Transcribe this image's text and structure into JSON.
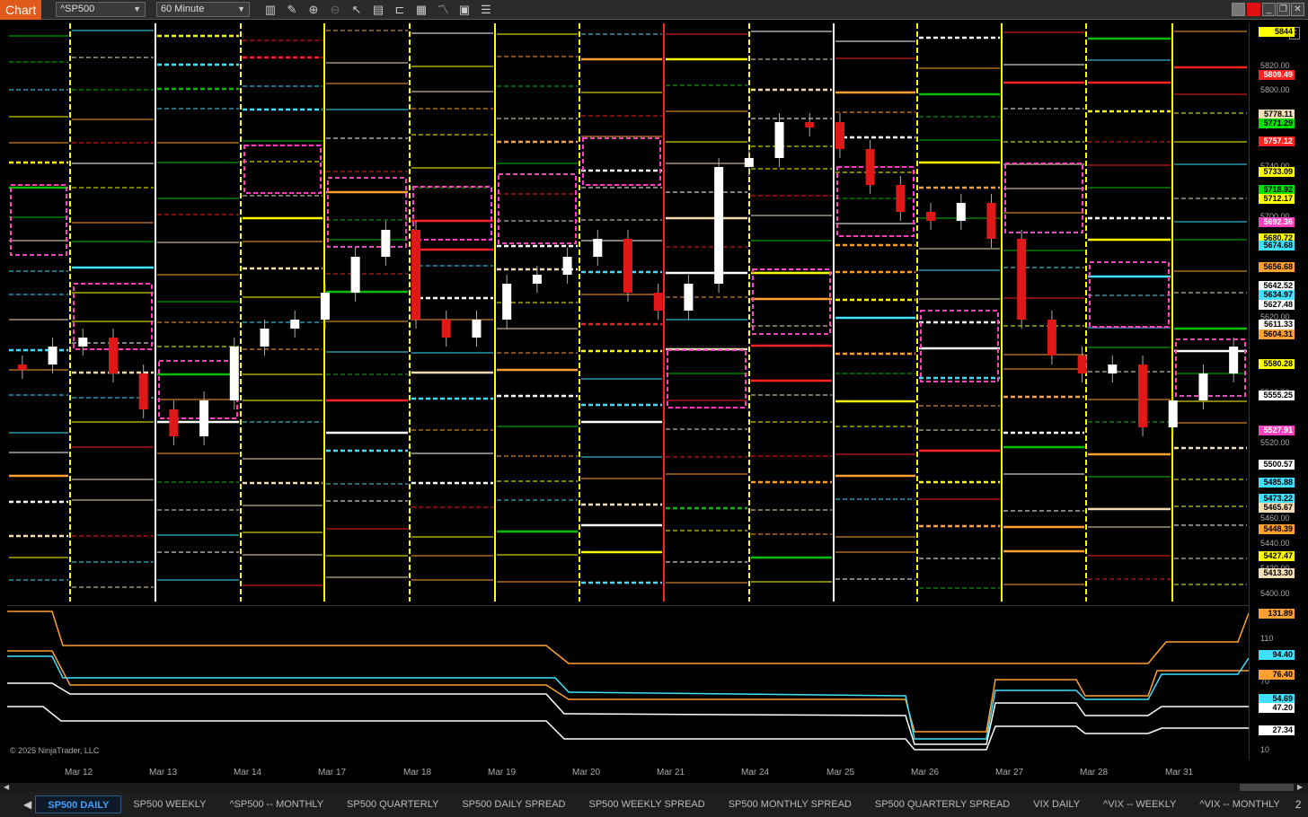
{
  "toolbar": {
    "chart_label": "Chart",
    "instrument": "^SP500",
    "interval": "60 Minute"
  },
  "copyright": "© 2025 NinjaTrader, LLC",
  "x_axis": [
    "Mar 12",
    "Mar 13",
    "Mar 14",
    "Mar 17",
    "Mar 18",
    "Mar 19",
    "Mar 20",
    "Mar 21",
    "Mar 24",
    "Mar 25",
    "Mar 26",
    "Mar 27",
    "Mar 28",
    "Mar 31"
  ],
  "price_axis_labels": [
    "5820.00",
    "5800.00",
    "5740.00",
    "5700.00",
    "5620.00",
    "5560.00",
    "5520.00",
    "5460.00",
    "5440.00",
    "5420.00",
    "5400.00"
  ],
  "price_tags": [
    {
      "text": "5844",
      "color": "#ffff00",
      "fg": "#000"
    },
    {
      "text": "5809.49",
      "color": "#ff2020",
      "fg": "#fff"
    },
    {
      "text": "5778.11",
      "color": "#f5deb3",
      "fg": "#000"
    },
    {
      "text": "5771.29",
      "color": "#00e000",
      "fg": "#000"
    },
    {
      "text": "5757.12",
      "color": "#ff2020",
      "fg": "#fff"
    },
    {
      "text": "5733.09",
      "color": "#ffff00",
      "fg": "#000"
    },
    {
      "text": "5718.92",
      "color": "#00e000",
      "fg": "#000"
    },
    {
      "text": "5712.17",
      "color": "#ffff00",
      "fg": "#000"
    },
    {
      "text": "5692.36",
      "color": "#ff40c0",
      "fg": "#fff"
    },
    {
      "text": "5680.72",
      "color": "#ffff00",
      "fg": "#000"
    },
    {
      "text": "5674.68",
      "color": "#40e0ff",
      "fg": "#000"
    },
    {
      "text": "5656.68",
      "color": "#ffa030",
      "fg": "#000"
    },
    {
      "text": "5642.52",
      "color": "#ffffff",
      "fg": "#000"
    },
    {
      "text": "5634.97",
      "color": "#40e0ff",
      "fg": "#000"
    },
    {
      "text": "5627.48",
      "color": "#ffffff",
      "fg": "#000"
    },
    {
      "text": "5611.33",
      "color": "#ffffff",
      "fg": "#000"
    },
    {
      "text": "5604.31",
      "color": "#ffa030",
      "fg": "#000"
    },
    {
      "text": "5580.28",
      "color": "#ffff00",
      "fg": "#000"
    },
    {
      "text": "5555.25",
      "color": "#ffffff",
      "fg": "#000"
    },
    {
      "text": "5527.91",
      "color": "#ff40c0",
      "fg": "#fff"
    },
    {
      "text": "5500.57",
      "color": "#ffffff",
      "fg": "#000"
    },
    {
      "text": "5485.88",
      "color": "#40e0ff",
      "fg": "#000"
    },
    {
      "text": "5473.22",
      "color": "#40e0ff",
      "fg": "#000"
    },
    {
      "text": "5465.67",
      "color": "#f5deb3",
      "fg": "#000"
    },
    {
      "text": "5448.39",
      "color": "#ffa030",
      "fg": "#000"
    },
    {
      "text": "5427.47",
      "color": "#ffff00",
      "fg": "#000"
    },
    {
      "text": "5413.30",
      "color": "#f5deb3",
      "fg": "#000"
    }
  ],
  "indicator_axis_labels": [
    "110",
    "70",
    "10"
  ],
  "indicator_tags": [
    {
      "text": "131.89",
      "color": "#ffa030",
      "fg": "#000"
    },
    {
      "text": "94.40",
      "color": "#40e0ff",
      "fg": "#000"
    },
    {
      "text": "76.40",
      "color": "#ffa030",
      "fg": "#000"
    },
    {
      "text": "54.69",
      "color": "#40e0ff",
      "fg": "#000"
    },
    {
      "text": "47.20",
      "color": "#ffffff",
      "fg": "#000"
    },
    {
      "text": "27.34",
      "color": "#ffffff",
      "fg": "#000"
    }
  ],
  "tabs": [
    "SP500 DAILY",
    "SP500 WEEKLY",
    "^SP500 -- MONTHLY",
    "SP500 QUARTERLY",
    "SP500 DAILY SPREAD",
    "SP500 WEEKLY SPREAD",
    "SP500 MONTHLY SPREAD",
    "SP500 QUARTERLY SPREAD",
    "VIX DAILY",
    "^VIX -- WEEKLY",
    "^VIX -- MONTHLY"
  ],
  "tab_page": "2",
  "active_tab": "SP500 DAILY",
  "colors": {
    "yellow": "#ffff00",
    "orange": "#ffa030",
    "cyan": "#40e0ff",
    "green": "#00c000",
    "red": "#ff2020",
    "magenta": "#ff40c0",
    "white": "#ffffff",
    "wheat": "#f5deb3",
    "accent": "#e05a1c"
  }
}
